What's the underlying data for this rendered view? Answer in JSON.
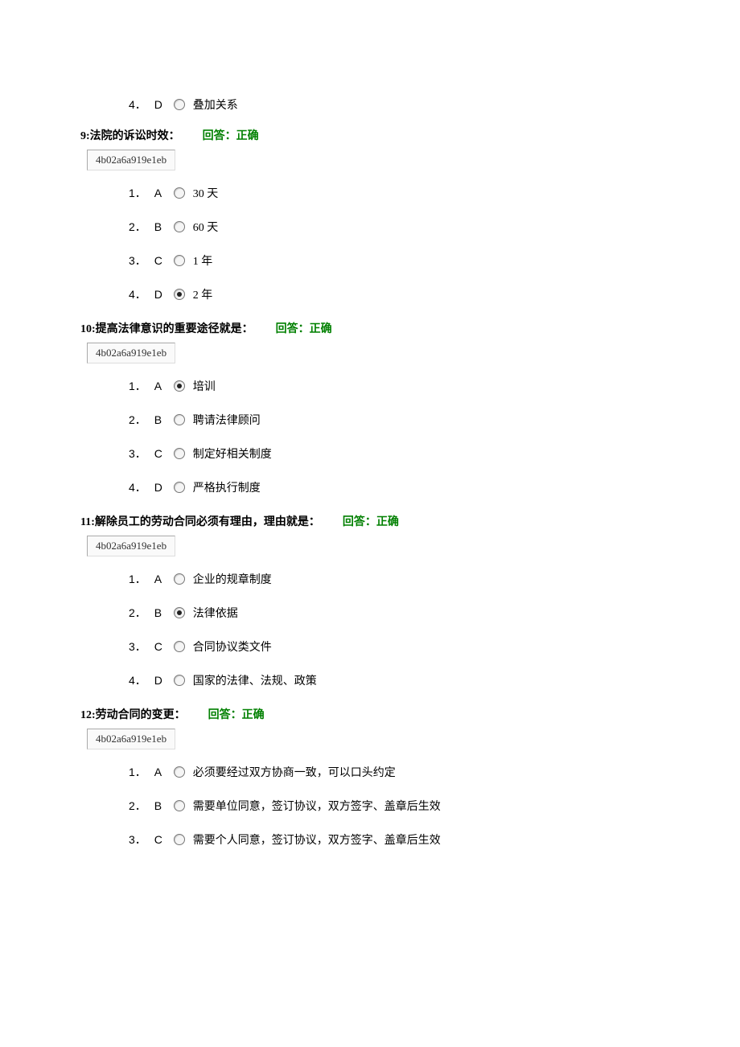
{
  "partial_option": {
    "num": "4．",
    "letter": "D",
    "selected": false,
    "text": "叠加关系"
  },
  "code": "4b02a6a919e1eb",
  "feedback_label": "回答：正确",
  "questions": [
    {
      "num": "9:",
      "text": "法院的诉讼时效：",
      "options": [
        {
          "n": "1．",
          "letter": "A",
          "selected": false,
          "text": "30 天"
        },
        {
          "n": "2．",
          "letter": "B",
          "selected": false,
          "text": "60 天"
        },
        {
          "n": "3．",
          "letter": "C",
          "selected": false,
          "text": "1 年"
        },
        {
          "n": "4．",
          "letter": "D",
          "selected": true,
          "text": "2 年"
        }
      ]
    },
    {
      "num": "10:",
      "text": "提高法律意识的重要途径就是：",
      "options": [
        {
          "n": "1．",
          "letter": "A",
          "selected": true,
          "text": "培训"
        },
        {
          "n": "2．",
          "letter": "B",
          "selected": false,
          "text": "聘请法律顾问"
        },
        {
          "n": "3．",
          "letter": "C",
          "selected": false,
          "text": "制定好相关制度"
        },
        {
          "n": "4．",
          "letter": "D",
          "selected": false,
          "text": "严格执行制度"
        }
      ]
    },
    {
      "num": "11:",
      "text": "解除员工的劳动合同必须有理由，理由就是：",
      "options": [
        {
          "n": "1．",
          "letter": "A",
          "selected": false,
          "text": "企业的规章制度"
        },
        {
          "n": "2．",
          "letter": "B",
          "selected": true,
          "text": "法律依据"
        },
        {
          "n": "3．",
          "letter": "C",
          "selected": false,
          "text": "合同协议类文件"
        },
        {
          "n": "4．",
          "letter": "D",
          "selected": false,
          "text": "国家的法律、法规、政策"
        }
      ]
    },
    {
      "num": "12:",
      "text": "劳动合同的变更：",
      "options": [
        {
          "n": "1．",
          "letter": "A",
          "selected": false,
          "text": "必须要经过双方协商一致，可以口头约定"
        },
        {
          "n": "2．",
          "letter": "B",
          "selected": false,
          "text": "需要单位同意，签订协议，双方签字、盖章后生效"
        },
        {
          "n": "3．",
          "letter": "C",
          "selected": false,
          "text": "需要个人同意，签订协议，双方签字、盖章后生效"
        }
      ]
    }
  ]
}
